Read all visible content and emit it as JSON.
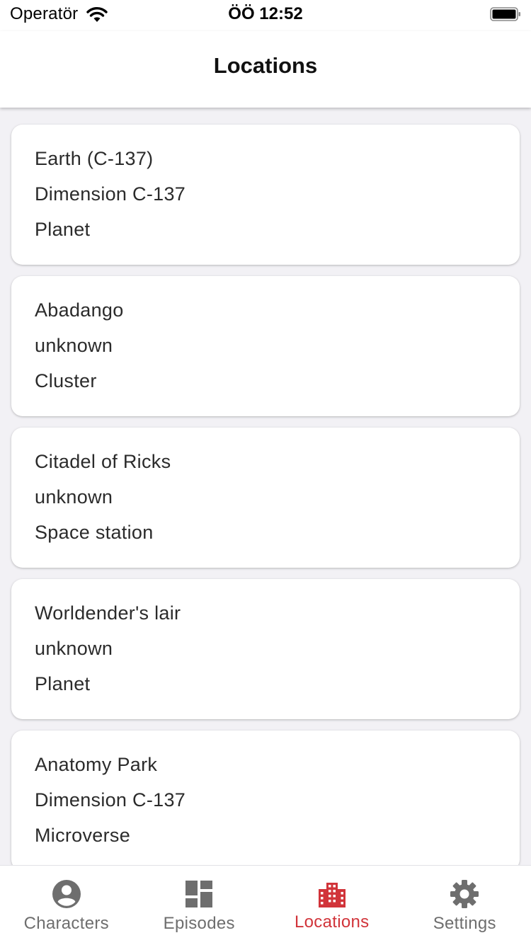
{
  "status_bar": {
    "carrier": "Operatör",
    "time": "ÖÖ 12:52"
  },
  "header": {
    "title": "Locations"
  },
  "locations": [
    {
      "name": "Earth (C-137)",
      "dimension": "Dimension C-137",
      "type": "Planet"
    },
    {
      "name": "Abadango",
      "dimension": "unknown",
      "type": "Cluster"
    },
    {
      "name": "Citadel of Ricks",
      "dimension": "unknown",
      "type": "Space station"
    },
    {
      "name": "Worldender's lair",
      "dimension": "unknown",
      "type": "Planet"
    },
    {
      "name": "Anatomy Park",
      "dimension": "Dimension C-137",
      "type": "Microverse"
    }
  ],
  "tab_bar": {
    "tabs": [
      {
        "label": "Characters",
        "icon": "person-icon",
        "active": false
      },
      {
        "label": "Episodes",
        "icon": "dashboard-icon",
        "active": false
      },
      {
        "label": "Locations",
        "icon": "building-icon",
        "active": true
      },
      {
        "label": "Settings",
        "icon": "gear-icon",
        "active": false
      }
    ]
  },
  "colors": {
    "accent": "#d1343a",
    "inactive": "#6e6e6e",
    "background": "#f2f1f5"
  }
}
